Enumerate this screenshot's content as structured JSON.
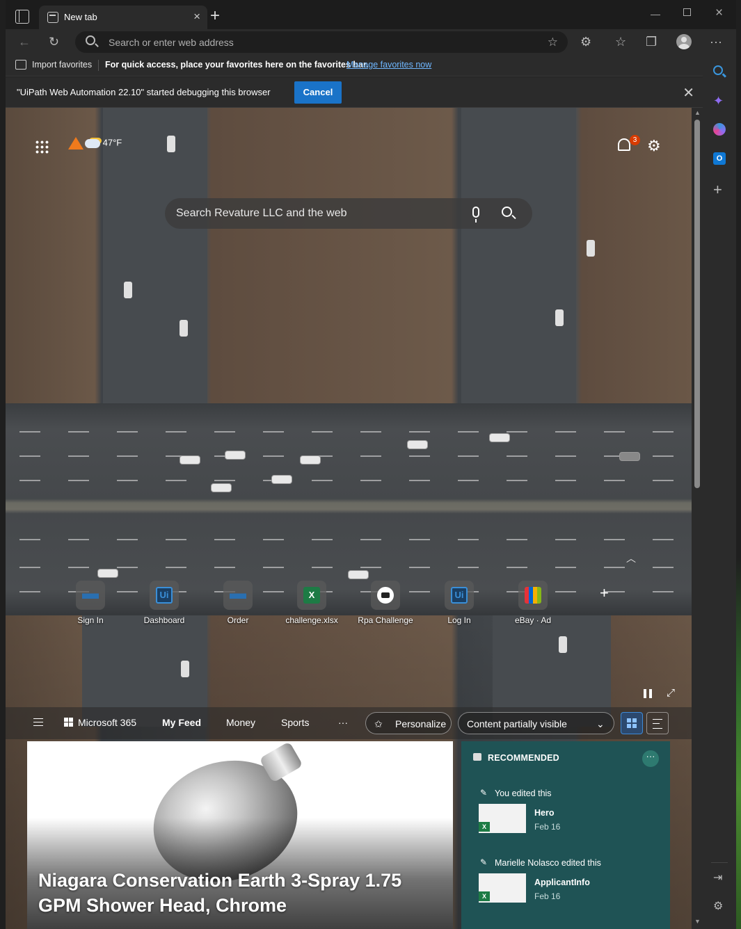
{
  "browser": {
    "tab_title": "New tab",
    "address_placeholder": "Search or enter web address"
  },
  "favorites_bar": {
    "import_label": "Import favorites",
    "message": "For quick access, place your favorites here on the favorites bar.",
    "manage_link": "Manage favorites now"
  },
  "debug_bar": {
    "message": "\"UiPath Web Automation 22.10\" started debugging this browser",
    "cancel_label": "Cancel"
  },
  "newtab": {
    "weather_temp": "47°F",
    "notification_count": "3",
    "search_placeholder": "Search Revature LLC and the web",
    "quick_links": [
      {
        "label": "Sign In",
        "icon": "ship-icon"
      },
      {
        "label": "Dashboard",
        "icon": "uipath-icon"
      },
      {
        "label": "Order",
        "icon": "ship-icon"
      },
      {
        "label": "challenge.xlsx",
        "icon": "excel-icon"
      },
      {
        "label": "Rpa Challenge",
        "icon": "robot-icon"
      },
      {
        "label": "Log In",
        "icon": "uipath-icon"
      },
      {
        "label": "eBay · Ad",
        "icon": "ebay-icon"
      }
    ]
  },
  "feed_nav": {
    "microsoft365": "Microsoft 365",
    "tabs": [
      "My Feed",
      "Money",
      "Sports"
    ],
    "more": "···",
    "personalize": "Personalize",
    "content_visibility": "Content partially visible"
  },
  "article": {
    "headline": "Niagara Conservation Earth 3-Spray 1.75 GPM Shower Head, Chrome"
  },
  "recommended": {
    "header": "RECOMMENDED",
    "items": [
      {
        "by": "You edited this",
        "name": "Hero",
        "date": "Feb 16"
      },
      {
        "by": "Marielle Nolasco edited this",
        "name": "ApplicantInfo",
        "date": "Feb 16"
      }
    ]
  },
  "colors": {
    "accent": "#1a73c8",
    "link": "#6fb7ff",
    "recommended_bg": "#1f5355",
    "badge": "#d83b01"
  }
}
